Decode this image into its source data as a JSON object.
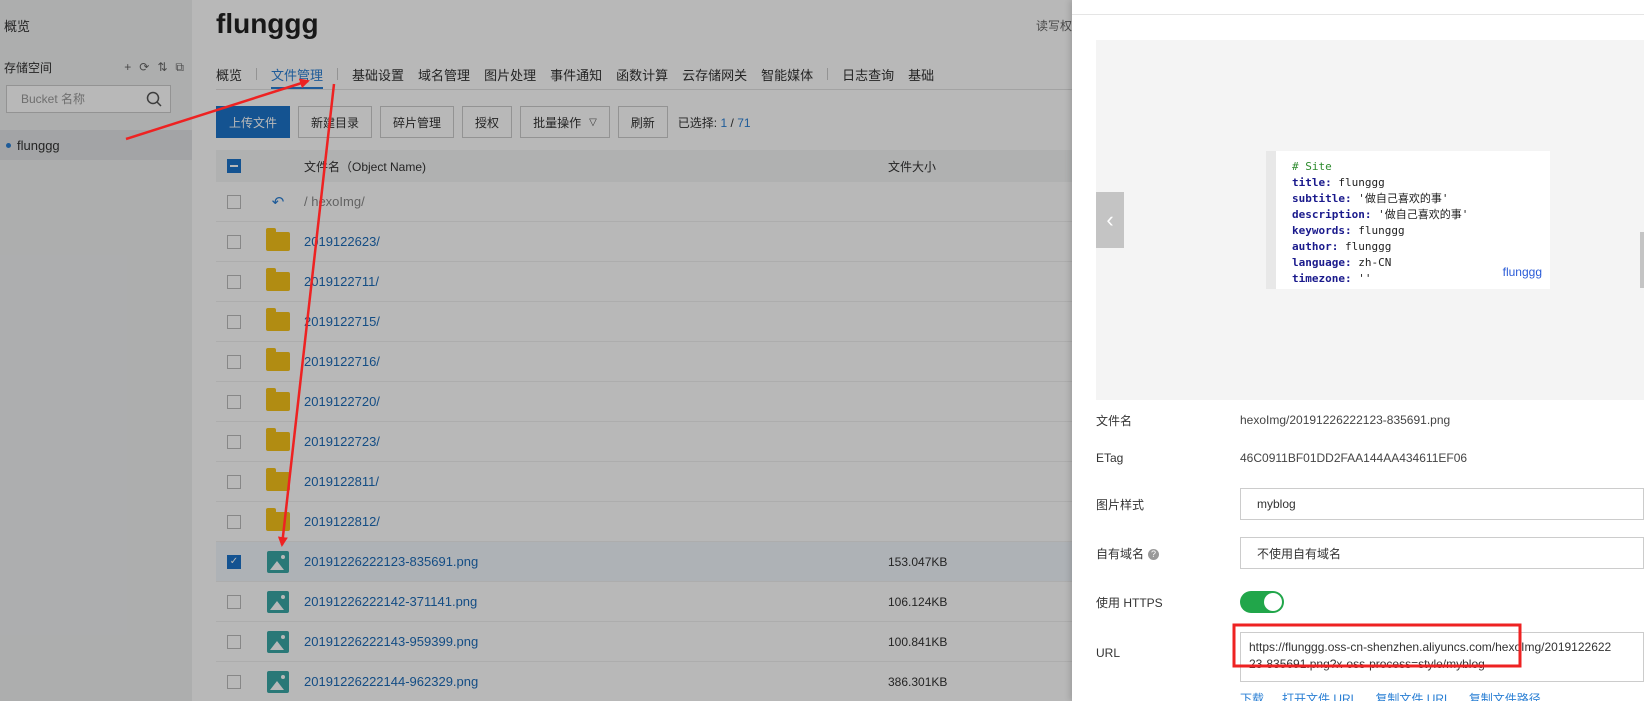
{
  "sidebar": {
    "overview": "概览",
    "storage_label": "存储空间",
    "tool_icons": [
      "+",
      "⟳",
      "⇅",
      "⧉"
    ],
    "search_placeholder": "Bucket 名称",
    "bucket": "flunggg"
  },
  "header": {
    "title": "flunggg",
    "rw_label": "读写权"
  },
  "tabs": [
    "概览",
    "文件管理",
    "基础设置",
    "域名管理",
    "图片处理",
    "事件通知",
    "函数计算",
    "云存储网关",
    "智能媒体",
    "日志查询",
    "基础"
  ],
  "toolbar": {
    "upload": "上传文件",
    "new_dir": "新建目录",
    "fragments": "碎片管理",
    "authorize": "授权",
    "batch": "批量操作",
    "refresh": "刷新",
    "selected_label": "已选择:",
    "selected_count": "1",
    "total": "71"
  },
  "table": {
    "col_name": "文件名（Object Name)",
    "col_size": "文件大小",
    "path_row": "/ hexoImg/",
    "rows": [
      {
        "name": "2019122623/",
        "type": "folder",
        "size": "",
        "checked": false
      },
      {
        "name": "2019122711/",
        "type": "folder",
        "size": "",
        "checked": false
      },
      {
        "name": "2019122715/",
        "type": "folder",
        "size": "",
        "checked": false
      },
      {
        "name": "2019122716/",
        "type": "folder",
        "size": "",
        "checked": false
      },
      {
        "name": "2019122720/",
        "type": "folder",
        "size": "",
        "checked": false
      },
      {
        "name": "2019122723/",
        "type": "folder",
        "size": "",
        "checked": false
      },
      {
        "name": "2019122811/",
        "type": "folder",
        "size": "",
        "checked": false
      },
      {
        "name": "2019122812/",
        "type": "folder",
        "size": "",
        "checked": false
      },
      {
        "name": "20191226222123-835691.png",
        "type": "image",
        "size": "153.047KB",
        "checked": true
      },
      {
        "name": "20191226222142-371141.png",
        "type": "image",
        "size": "106.124KB",
        "checked": false
      },
      {
        "name": "20191226222143-959399.png",
        "type": "image",
        "size": "100.841KB",
        "checked": false
      },
      {
        "name": "20191226222144-962329.png",
        "type": "image",
        "size": "386.301KB",
        "checked": false
      }
    ]
  },
  "preview": {
    "code_lines": [
      {
        "key": "# Site",
        "val": "",
        "comment": true
      },
      {
        "key": "title:",
        "val": " flunggg"
      },
      {
        "key": "subtitle:",
        "val": " '做自己喜欢的事'"
      },
      {
        "key": "description:",
        "val": " '做自己喜欢的事'"
      },
      {
        "key": "keywords:",
        "val": " flunggg"
      },
      {
        "key": "author:",
        "val": " flunggg"
      },
      {
        "key": "language:",
        "val": " zh-CN"
      },
      {
        "key": "timezone:",
        "val": " ''"
      }
    ],
    "watermark": "flunggg"
  },
  "details": {
    "filename_label": "文件名",
    "filename": "hexoImg/20191226222123-835691.png",
    "etag_label": "ETag",
    "etag": "46C0911BF01DD2FAA144AA434611EF06",
    "style_label": "图片样式",
    "style": "myblog",
    "domain_label": "自有域名",
    "domain": "不使用自有域名",
    "https_label": "使用 HTTPS",
    "https_on": true,
    "url_label": "URL",
    "url_line1": "https://flunggg.oss-cn-shenzhen.aliyuncs.com/hexoImg/2019122622",
    "url_line2": "23-835691.png?x-oss-process=style/myblog",
    "links": [
      "下载",
      "打开文件 URL",
      "复制文件 URL",
      "复制文件路径"
    ]
  },
  "colors": {
    "accent": "#1c74c9",
    "folder": "#f5c21a",
    "toggle_on": "#21a64a",
    "annotation": "#ee2222"
  }
}
